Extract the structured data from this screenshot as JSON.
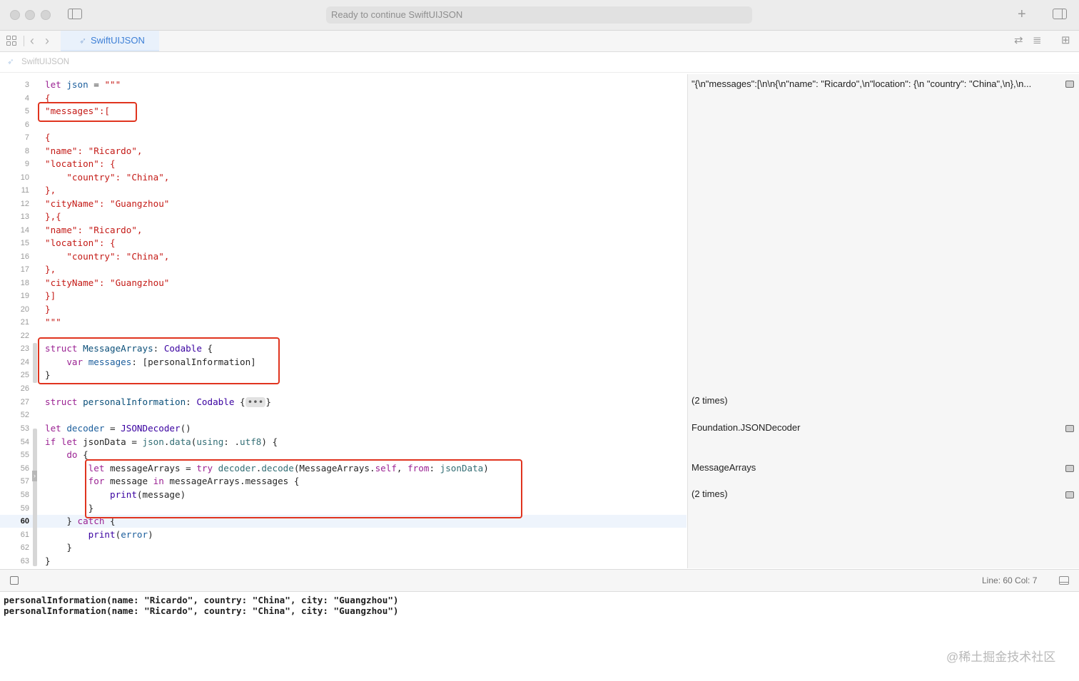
{
  "window": {
    "activity_status": "Ready to continue SwiftUIJSON",
    "tab_label": "SwiftUIJSON",
    "breadcrumb": "SwiftUIJSON"
  },
  "icons": {
    "sidebar_toggle": "sidebar-icon",
    "add": "plus-icon",
    "inspector_toggle": "inspector-icon",
    "grid": "grid-icon",
    "back": "chevron-left-icon",
    "forward": "chevron-right-icon",
    "swift": "swift-icon",
    "show_result": "result-icon"
  },
  "glyphs": {
    "plus": "+",
    "back": "‹",
    "forward": "›",
    "swift": "➶",
    "sync": "⇄",
    "lines": "≣",
    "addpanel": "⊞",
    "fold": "›"
  },
  "editor": {
    "current_line": "60",
    "lines": [
      {
        "n": "3",
        "tokens": [
          {
            "c": "t-kw",
            "t": "let"
          },
          {
            "t": " "
          },
          {
            "c": "t-blue",
            "t": "json"
          },
          {
            "t": " = "
          },
          {
            "c": "t-str",
            "t": "\"\"\""
          }
        ]
      },
      {
        "n": "4",
        "tokens": [
          {
            "c": "t-str",
            "t": "{"
          }
        ]
      },
      {
        "n": "5",
        "tokens": [
          {
            "c": "t-str",
            "t": "\"messages\":["
          }
        ]
      },
      {
        "n": "6",
        "tokens": []
      },
      {
        "n": "7",
        "tokens": [
          {
            "c": "t-str",
            "t": "{"
          }
        ]
      },
      {
        "n": "8",
        "tokens": [
          {
            "c": "t-str",
            "t": "\"name\": \"Ricardo\","
          }
        ]
      },
      {
        "n": "9",
        "tokens": [
          {
            "c": "t-str",
            "t": "\"location\": {"
          }
        ]
      },
      {
        "n": "10",
        "tokens": [
          {
            "c": "t-str",
            "t": "    \"country\": \"China\","
          }
        ]
      },
      {
        "n": "11",
        "tokens": [
          {
            "c": "t-str",
            "t": "},"
          }
        ]
      },
      {
        "n": "12",
        "tokens": [
          {
            "c": "t-str",
            "t": "\"cityName\": \"Guangzhou\""
          }
        ]
      },
      {
        "n": "13",
        "tokens": [
          {
            "c": "t-str",
            "t": "},{"
          }
        ]
      },
      {
        "n": "14",
        "tokens": [
          {
            "c": "t-str",
            "t": "\"name\": \"Ricardo\","
          }
        ]
      },
      {
        "n": "15",
        "tokens": [
          {
            "c": "t-str",
            "t": "\"location\": {"
          }
        ]
      },
      {
        "n": "16",
        "tokens": [
          {
            "c": "t-str",
            "t": "    \"country\": \"China\","
          }
        ]
      },
      {
        "n": "17",
        "tokens": [
          {
            "c": "t-str",
            "t": "},"
          }
        ]
      },
      {
        "n": "18",
        "tokens": [
          {
            "c": "t-str",
            "t": "\"cityName\": \"Guangzhou\""
          }
        ]
      },
      {
        "n": "19",
        "tokens": [
          {
            "c": "t-str",
            "t": "}]"
          }
        ]
      },
      {
        "n": "20",
        "tokens": [
          {
            "c": "t-str",
            "t": "}"
          }
        ]
      },
      {
        "n": "21",
        "tokens": [
          {
            "c": "t-str",
            "t": "\"\"\""
          }
        ]
      },
      {
        "n": "22",
        "tokens": []
      },
      {
        "n": "23",
        "tokens": [
          {
            "c": "t-kw",
            "t": "struct"
          },
          {
            "t": " "
          },
          {
            "c": "t-type",
            "t": "MessageArrays"
          },
          {
            "t": ": "
          },
          {
            "c": "t-lib",
            "t": "Codable"
          },
          {
            "t": " {"
          }
        ]
      },
      {
        "n": "24",
        "tokens": [
          {
            "t": "    "
          },
          {
            "c": "t-kw",
            "t": "var"
          },
          {
            "t": " "
          },
          {
            "c": "t-blue",
            "t": "messages"
          },
          {
            "t": ": [personalInformation]"
          }
        ]
      },
      {
        "n": "25",
        "tokens": [
          {
            "t": "}"
          }
        ]
      },
      {
        "n": "26",
        "tokens": []
      },
      {
        "n": "27",
        "fold": "•••",
        "tokens": [
          {
            "c": "t-kw",
            "t": "struct"
          },
          {
            "t": " "
          },
          {
            "c": "t-type",
            "t": "personalInformation"
          },
          {
            "t": ": "
          },
          {
            "c": "t-lib",
            "t": "Codable"
          },
          {
            "t": " {"
          }
        ],
        "after": "}"
      },
      {
        "n": "52",
        "tokens": []
      },
      {
        "n": "53",
        "tokens": [
          {
            "c": "t-kw",
            "t": "let"
          },
          {
            "t": " "
          },
          {
            "c": "t-blue",
            "t": "decoder"
          },
          {
            "t": " = "
          },
          {
            "c": "t-lib",
            "t": "JSONDecoder"
          },
          {
            "t": "()"
          }
        ]
      },
      {
        "n": "54",
        "tokens": [
          {
            "c": "t-kw",
            "t": "if let"
          },
          {
            "t": " jsonData = "
          },
          {
            "c": "t-fn",
            "t": "json"
          },
          {
            "t": "."
          },
          {
            "c": "t-fn",
            "t": "data"
          },
          {
            "t": "("
          },
          {
            "c": "t-fn",
            "t": "using"
          },
          {
            "t": ": ."
          },
          {
            "c": "t-fn",
            "t": "utf8"
          },
          {
            "t": ") {"
          }
        ]
      },
      {
        "n": "55",
        "tokens": [
          {
            "t": "    "
          },
          {
            "c": "t-kw",
            "t": "do"
          },
          {
            "t": " {"
          }
        ]
      },
      {
        "n": "56",
        "tokens": [
          {
            "t": "        "
          },
          {
            "c": "t-kw",
            "t": "let"
          },
          {
            "t": " messageArrays = "
          },
          {
            "c": "t-kw",
            "t": "try"
          },
          {
            "t": " "
          },
          {
            "c": "t-fn",
            "t": "decoder"
          },
          {
            "t": "."
          },
          {
            "c": "t-fn",
            "t": "decode"
          },
          {
            "t": "(MessageArrays."
          },
          {
            "c": "t-kw",
            "t": "self"
          },
          {
            "t": ", "
          },
          {
            "c": "t-kw",
            "t": "from"
          },
          {
            "t": ": "
          },
          {
            "c": "t-fn",
            "t": "jsonData"
          },
          {
            "t": ")"
          }
        ]
      },
      {
        "n": "57",
        "tokens": [
          {
            "t": "        "
          },
          {
            "c": "t-kw",
            "t": "for"
          },
          {
            "t": " message "
          },
          {
            "c": "t-kw",
            "t": "in"
          },
          {
            "t": " messageArrays.messages {"
          }
        ]
      },
      {
        "n": "58",
        "tokens": [
          {
            "t": "            "
          },
          {
            "c": "t-lib",
            "t": "print"
          },
          {
            "t": "(message)"
          }
        ]
      },
      {
        "n": "59",
        "tokens": [
          {
            "t": "        }"
          }
        ]
      },
      {
        "n": "60",
        "tokens": [
          {
            "t": "    } "
          },
          {
            "c": "t-kw",
            "t": "catch"
          },
          {
            "t": " {"
          }
        ]
      },
      {
        "n": "61",
        "tokens": [
          {
            "t": "        "
          },
          {
            "c": "t-lib",
            "t": "print"
          },
          {
            "t": "("
          },
          {
            "c": "t-blue",
            "t": "error"
          },
          {
            "t": ")"
          }
        ]
      },
      {
        "n": "62",
        "tokens": [
          {
            "t": "    }"
          }
        ]
      },
      {
        "n": "63",
        "tokens": [
          {
            "t": "}"
          }
        ]
      }
    ]
  },
  "results": {
    "json_value": "\"{\\n\"messages\":[\\n\\n{\\n\"name\": \"Ricardo\",\\n\"location\": {\\n    \"country\": \"China\",\\n},\\n...",
    "personal_info_runs": "(2 times)",
    "decoder_value": "Foundation.JSONDecoder",
    "message_arrays_value": "MessageArrays",
    "loop_runs": "(2 times)"
  },
  "statusbar": {
    "position": "Line: 60  Col: 7"
  },
  "console": {
    "lines": [
      "personalInformation(name: \"Ricardo\", country: \"China\", city: \"Guangzhou\")",
      "personalInformation(name: \"Ricardo\", country: \"China\", city: \"Guangzhou\")"
    ]
  },
  "watermark": "@稀土掘金技术社区"
}
